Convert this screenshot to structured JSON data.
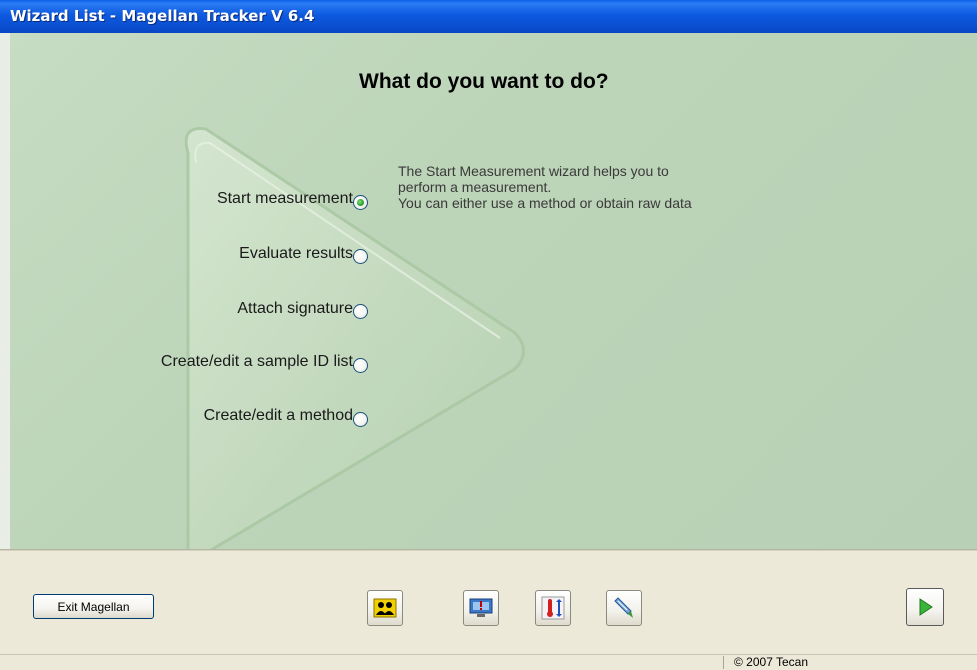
{
  "window": {
    "title": "Wizard List - Magellan Tracker V 6.4"
  },
  "main": {
    "heading": "What do you want to do?",
    "options": [
      {
        "label": "Start measurement",
        "checked": true
      },
      {
        "label": "Evaluate results",
        "checked": false
      },
      {
        "label": "Attach signature",
        "checked": false
      },
      {
        "label": "Create/edit a sample ID list",
        "checked": false
      },
      {
        "label": "Create/edit a method",
        "checked": false
      }
    ],
    "description": [
      "The Start Measurement wizard helps you to",
      "perform a measurement.",
      "You can either use a method or obtain raw data"
    ]
  },
  "footer": {
    "exit_label": "Exit Magellan",
    "tool_icons": [
      "users-icon",
      "screen-alert-icon",
      "thermometer-icon",
      "pipette-icon"
    ],
    "next_icon": "play-arrow-icon"
  },
  "status": {
    "copyright": "© 2007 Tecan"
  },
  "colors": {
    "titlebar": "#0a4fd0",
    "panel": "#c2d8bf",
    "accent_green": "#2aa02a"
  }
}
